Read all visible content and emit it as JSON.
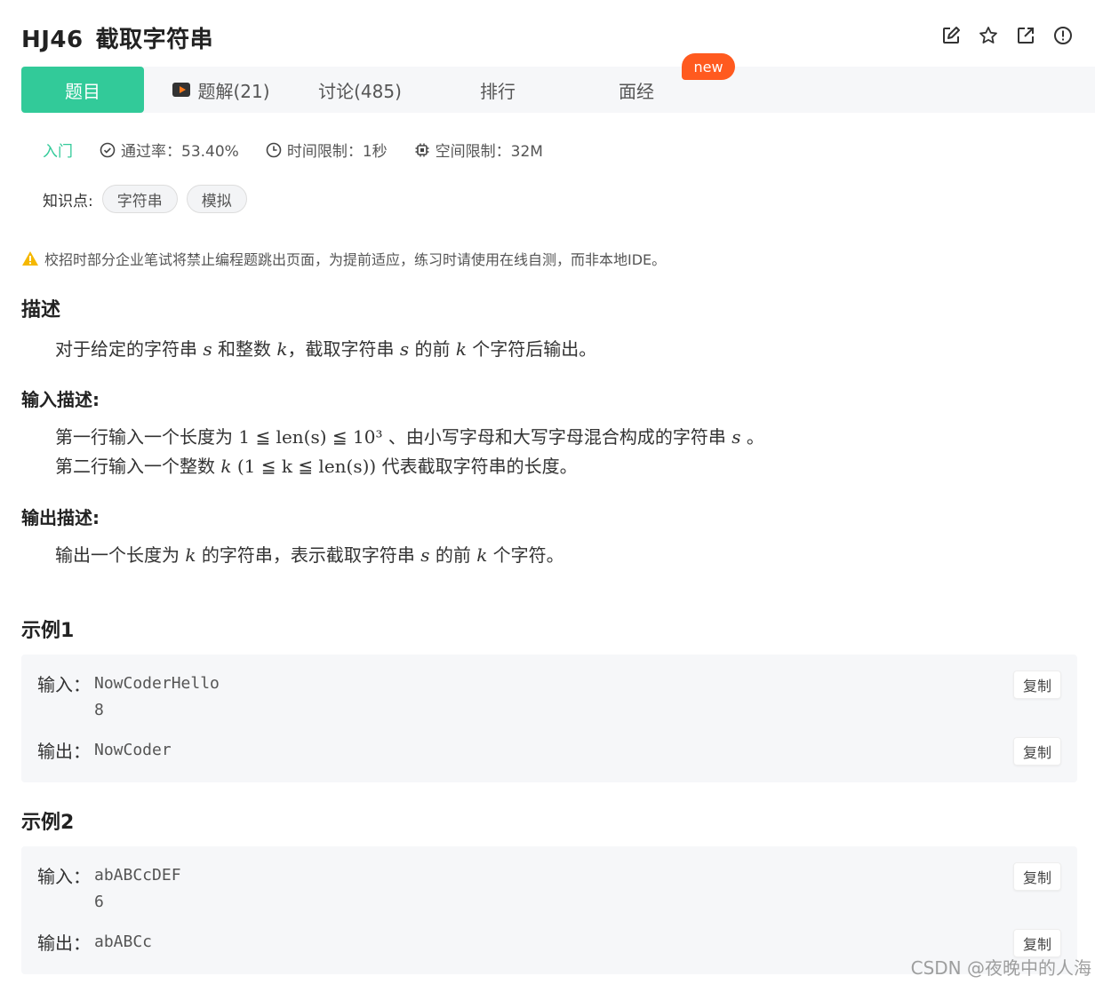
{
  "header": {
    "problem_id": "HJ46",
    "problem_title": "截取字符串"
  },
  "tabs": [
    {
      "label": "题目"
    },
    {
      "label": "题解(21)"
    },
    {
      "label": "讨论(485)"
    },
    {
      "label": "排行"
    },
    {
      "label": "面经"
    }
  ],
  "new_badge": "new",
  "meta": {
    "level": "入门",
    "pass_rate": "通过率：53.40%",
    "time_limit": "时间限制：1秒",
    "space_limit": "空间限制：32M"
  },
  "knowledge": {
    "label": "知识点:",
    "tags": [
      "字符串",
      "模拟"
    ]
  },
  "warning": "校招时部分企业笔试将禁止编程题跳出页面，为提前适应，练习时请使用在线自测，而非本地IDE。",
  "description": {
    "title": "描述",
    "p1": "对于给定的字符串",
    "v_s": "s",
    "p2": "和整数",
    "v_k": "k",
    "p3": "，截取字符串",
    "p4": "的前",
    "p5": "个字符后输出。"
  },
  "input_desc": {
    "title": "输入描述:",
    "l1_a": "第一行输入一个长度为",
    "l1_math": "1 ≦ len(s) ≦ 10³",
    "l1_b": "、由小写字母和大写字母混合构成的字符串",
    "l1_s": "s",
    "l1_c": "。",
    "l2_a": "第二行输入一个整数",
    "l2_k": "k",
    "l2_math": "(1 ≦ k ≦ len(s))",
    "l2_b": "代表截取字符串的长度。"
  },
  "output_desc": {
    "title": "输出描述:",
    "a": "输出一个长度为",
    "k": "k",
    "b": "的字符串，表示截取字符串",
    "s": "s",
    "c": "的前",
    "d": "个字符。"
  },
  "examples": [
    {
      "title": "示例1",
      "input_label": "输入：",
      "input_lines": [
        "NowCoderHello",
        "8"
      ],
      "output_label": "输出：",
      "output": "NowCoder",
      "copy": "复制"
    },
    {
      "title": "示例2",
      "input_label": "输入：",
      "input_lines": [
        "abABCcDEF",
        "6"
      ],
      "output_label": "输出：",
      "output": "abABCc",
      "copy": "复制"
    }
  ],
  "watermark": "CSDN @夜晚中的人海",
  "colors": {
    "accent": "#32ca99",
    "badge": "#ff5a1f",
    "warning": "#f5b800"
  }
}
